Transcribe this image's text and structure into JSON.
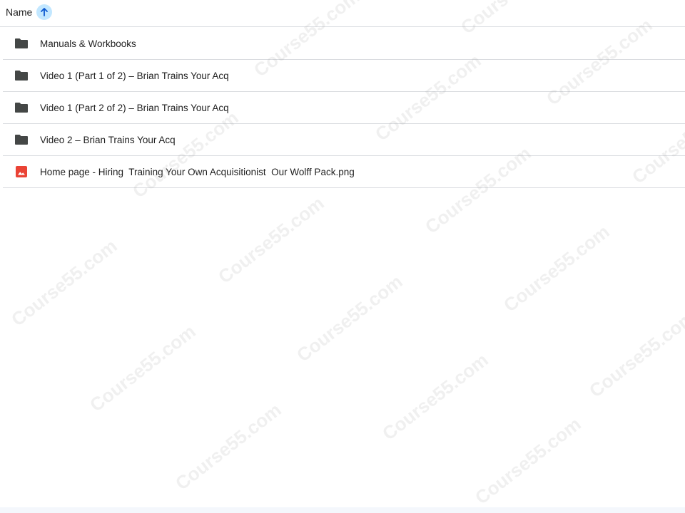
{
  "header": {
    "column_label": "Name",
    "sort_icon": "arrow-up-icon"
  },
  "files": [
    {
      "name": "Manuals & Workbooks",
      "type": "folder",
      "icon": "folder-icon"
    },
    {
      "name": "Video 1 (Part 1 of 2) – Brian Trains Your Acq",
      "type": "folder",
      "icon": "folder-icon"
    },
    {
      "name": "Video 1 (Part 2 of 2) – Brian Trains Your Acq",
      "type": "folder",
      "icon": "folder-icon"
    },
    {
      "name": "Video 2 – Brian Trains Your Acq",
      "type": "folder",
      "icon": "folder-icon"
    },
    {
      "name": "Home page - Hiring  Training Your Own Acquisitionist  Our Wolff Pack.png",
      "type": "image",
      "icon": "image-file-icon"
    }
  ],
  "colors": {
    "folder": "#444746",
    "image_file": "#ea4335",
    "sort_highlight": "#c2e7ff",
    "divider": "#dadce0"
  },
  "watermark_text": "Course55.com"
}
